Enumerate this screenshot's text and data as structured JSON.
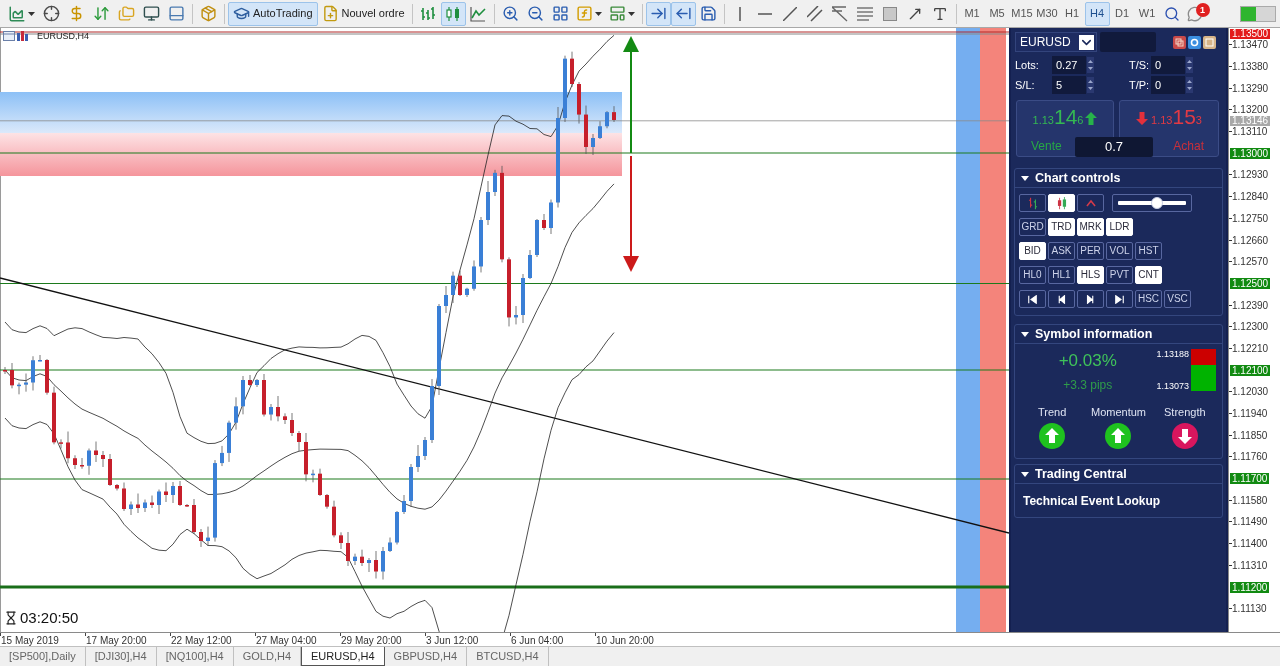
{
  "toolbar": {
    "autotrading": {
      "label": "AutoTrading",
      "on": true
    },
    "new_order": {
      "label": "Nouvel ordre"
    },
    "chart_types": [
      {
        "selected": false
      },
      {
        "selected": true
      },
      {
        "selected": false
      }
    ],
    "auto_scroll": {
      "on": true
    },
    "chart_shift": {
      "on": true
    },
    "timeframes": [
      {
        "label": "M1",
        "selected": false
      },
      {
        "label": "M5",
        "selected": false
      },
      {
        "label": "M15",
        "selected": false
      },
      {
        "label": "M30",
        "selected": false
      },
      {
        "label": "H1",
        "selected": false
      },
      {
        "label": "H4",
        "selected": true
      },
      {
        "label": "D1",
        "selected": false
      },
      {
        "label": "W1",
        "selected": false
      }
    ],
    "notifications": {
      "count": "1"
    }
  },
  "chart": {
    "title": "EURUSD,H4",
    "countdown": "03:20:50",
    "price_axis": [
      {
        "kind": "marker",
        "text": "1.13500",
        "color": "#e31b1b"
      },
      {
        "kind": "tick",
        "text": "1.13470"
      },
      {
        "kind": "tick",
        "text": "1.13380"
      },
      {
        "kind": "tick",
        "text": "1.13290"
      },
      {
        "kind": "tick",
        "text": "1.13200"
      },
      {
        "kind": "marker",
        "text": "1.13146",
        "color": "#a8a8a8"
      },
      {
        "kind": "tick",
        "text": "1.13110"
      },
      {
        "kind": "level",
        "text": "1.13000",
        "color": "#118a11"
      },
      {
        "kind": "tick",
        "text": "1.12930"
      },
      {
        "kind": "tick",
        "text": "1.12840"
      },
      {
        "kind": "tick",
        "text": "1.12750"
      },
      {
        "kind": "tick",
        "text": "1.12660"
      },
      {
        "kind": "tick",
        "text": "1.12570"
      },
      {
        "kind": "level",
        "text": "1.12500",
        "color": "#118a11"
      },
      {
        "kind": "tick",
        "text": "1.12390"
      },
      {
        "kind": "tick",
        "text": "1.12300"
      },
      {
        "kind": "tick",
        "text": "1.12210"
      },
      {
        "kind": "level",
        "text": "1.12100",
        "color": "#118a11"
      },
      {
        "kind": "tick",
        "text": "1.12030"
      },
      {
        "kind": "tick",
        "text": "1.11940"
      },
      {
        "kind": "tick",
        "text": "1.11850"
      },
      {
        "kind": "tick",
        "text": "1.11760"
      },
      {
        "kind": "level",
        "text": "1.11700",
        "color": "#118a11"
      },
      {
        "kind": "tick",
        "text": "1.11580"
      },
      {
        "kind": "tick",
        "text": "1.11490"
      },
      {
        "kind": "tick",
        "text": "1.11400"
      },
      {
        "kind": "tick",
        "text": "1.11310"
      },
      {
        "kind": "level",
        "text": "1.11200",
        "color": "#118a11"
      },
      {
        "kind": "tick",
        "text": "1.11130"
      }
    ],
    "time_axis": [
      "15 May 2019",
      "17 May 20:00",
      "22 May 12:00",
      "27 May 04:00",
      "29 May 20:00",
      "3 Jun 12:00",
      "6 Jun 04:00",
      "10 Jun 20:00"
    ]
  },
  "panel": {
    "symbol": "EURUSD",
    "fields": [
      {
        "label": "Lots:",
        "value": "0.27"
      },
      {
        "label": "T/S:",
        "value": "0"
      },
      {
        "label": "S/L:",
        "value": "5"
      },
      {
        "label": "T/P:",
        "value": "0"
      }
    ],
    "sell": {
      "label": "Vente",
      "price": {
        "lead": "1.13",
        "pips": "14",
        "fraction": "6"
      }
    },
    "buy": {
      "label": "Achat",
      "price": {
        "lead": "1.13",
        "pips": "15",
        "fraction": "3"
      }
    },
    "spread": "0.7",
    "chart_controls": {
      "title": "Chart controls",
      "expanded": true,
      "chart_types": [
        {
          "selected": false
        },
        {
          "selected": true
        },
        {
          "selected": false
        }
      ],
      "zoom": {
        "level": 0.57
      },
      "toggle_rows": [
        {
          "buttons": [
            {
              "label": "GRD",
              "on": false
            },
            {
              "label": "TRD",
              "on": true
            },
            {
              "label": "MRK",
              "on": true
            },
            {
              "label": "LDR",
              "on": true
            }
          ]
        },
        {
          "buttons": [
            {
              "label": "BID",
              "on": true
            },
            {
              "label": "ASK",
              "on": false
            },
            {
              "label": "PER",
              "on": false
            },
            {
              "label": "VOL",
              "on": false
            },
            {
              "label": "HST",
              "on": false
            }
          ]
        },
        {
          "buttons": [
            {
              "label": "HL0",
              "on": false
            },
            {
              "label": "HL1",
              "on": false
            },
            {
              "label": "HLS",
              "on": true
            },
            {
              "label": "PVT",
              "on": false
            },
            {
              "label": "CNT",
              "on": true
            }
          ]
        }
      ],
      "scroll_buttons": [
        {
          "label": "HSC",
          "on": false
        },
        {
          "label": "VSC",
          "on": false
        }
      ]
    },
    "symbol_info": {
      "title": "Symbol information",
      "expanded": true,
      "change": "+0.03%",
      "pips": "+3.3 pips",
      "high": "1.13188",
      "low": "1.13073",
      "range": {
        "level": 0.63
      },
      "indicators": [
        {
          "label": "Trend",
          "rising": true
        },
        {
          "label": "Momentum",
          "rising": true
        },
        {
          "label": "Strength",
          "rising": false
        }
      ]
    },
    "trading_central": {
      "title": "Trading Central",
      "expanded": true,
      "link": "Technical Event Lookup"
    }
  },
  "tabs": [
    {
      "label": "[SP500],Daily",
      "selected": false
    },
    {
      "label": "[DJI30],H4",
      "selected": false
    },
    {
      "label": "[NQ100],H4",
      "selected": false
    },
    {
      "label": "GOLD,H4",
      "selected": false
    },
    {
      "label": "EURUSD,H4",
      "selected": true
    },
    {
      "label": "GBPUSD,H4",
      "selected": false
    },
    {
      "label": "BTCUSD,H4",
      "selected": false
    }
  ]
}
